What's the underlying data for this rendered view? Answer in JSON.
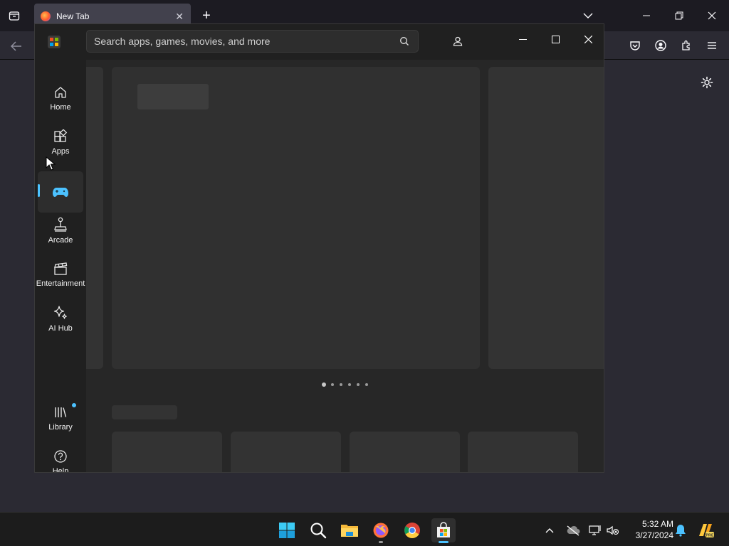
{
  "browser": {
    "tab_title": "New Tab",
    "new_tab_symbol": "+",
    "tab_close_symbol": "✕",
    "icons": [
      "tab-list-icon",
      "back-icon",
      "pocket-icon",
      "account-icon",
      "extensions-icon",
      "menu-icon",
      "settings-icon",
      "minimize-icon",
      "restore-icon",
      "close-icon",
      "list-all-tabs-icon"
    ]
  },
  "store": {
    "search_placeholder": "Search apps, games, movies, and more",
    "nav": [
      {
        "label": "Home",
        "icon": "home-icon"
      },
      {
        "label": "Apps",
        "icon": "apps-icon"
      },
      {
        "label": "",
        "icon": "gamepad-icon",
        "active": true
      },
      {
        "label": "Arcade",
        "icon": "joystick-icon"
      },
      {
        "label": "Entertainment",
        "icon": "clapperboard-icon"
      },
      {
        "label": "AI Hub",
        "icon": "sparkle-icon"
      },
      {
        "label": "Library",
        "icon": "library-icon",
        "badge": true
      },
      {
        "label": "Help",
        "icon": "help-icon"
      }
    ],
    "carousel_page_count": 6,
    "carousel_active_index": 0
  },
  "taskbar": {
    "time": "5:32 AM",
    "date": "3/27/2024",
    "apps": [
      "windows-start-icon",
      "search-icon",
      "file-explorer-icon",
      "firefox-icon",
      "chrome-icon",
      "microsoft-store-icon"
    ]
  },
  "colors": {
    "accent": "#4cc2ff",
    "store_bg": "#202020",
    "browser_bg": "#2b2a33"
  }
}
